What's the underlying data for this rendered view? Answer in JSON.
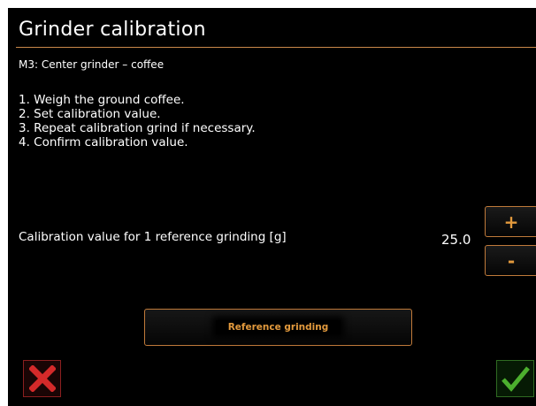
{
  "header": {
    "title": "Grinder calibration",
    "subtitle": "M3: Center grinder – coffee"
  },
  "instructions": [
    "1. Weigh the ground coffee.",
    "2. Set calibration value.",
    "3. Repeat calibration grind if necessary.",
    "4. Confirm calibration value."
  ],
  "calibration": {
    "label": "Calibration value for 1 reference grinding [g]",
    "value": "25.0",
    "plus_label": "+",
    "minus_label": "-"
  },
  "actions": {
    "reference_label": "Reference grinding",
    "cancel_icon": "close-icon",
    "confirm_icon": "checkmark-icon"
  },
  "colors": {
    "background": "#000000",
    "accent": "#e39a3d",
    "border_accent": "#c07a3a",
    "cancel": "#d42a2a",
    "confirm": "#4caf2e"
  }
}
